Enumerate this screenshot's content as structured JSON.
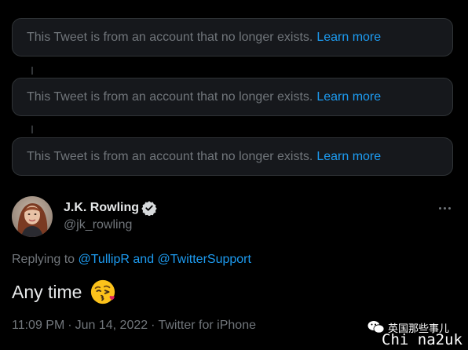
{
  "thread": {
    "notices": [
      {
        "message": "This Tweet is from an account that no longer exists.",
        "link": "Learn more"
      },
      {
        "message": "This Tweet is from an account that no longer exists.",
        "link": "Learn more"
      },
      {
        "message": "This Tweet is from an account that no longer exists.",
        "link": "Learn more"
      }
    ]
  },
  "tweet": {
    "author_name": "J.K. Rowling",
    "author_handle": "@jk_rowling",
    "verified_icon": "verified-badge-icon",
    "avatar_icon": "profile-photo",
    "more_icon": "more-options-icon",
    "replying_prefix": "Replying to",
    "mention_1": "@TullipR",
    "mention_joiner": "and",
    "mention_2": "@TwitterSupport",
    "text": "Any time",
    "emoji_icon": "face-blowing-kiss-emoji",
    "time": "11:09 PM",
    "date": "Jun 14, 2022",
    "separator": "·",
    "source": "Twitter for iPhone"
  },
  "watermark": {
    "chinese_text": "英国那些事儿",
    "site_text": "Chi na2uk",
    "icon": "wechat-logo-icon"
  },
  "colors": {
    "background": "#000000",
    "card_background": "#16181c",
    "card_border": "#2f3336",
    "primary_text": "#e7e9ea",
    "secondary_text": "#71767b",
    "link": "#1d9bf0"
  }
}
